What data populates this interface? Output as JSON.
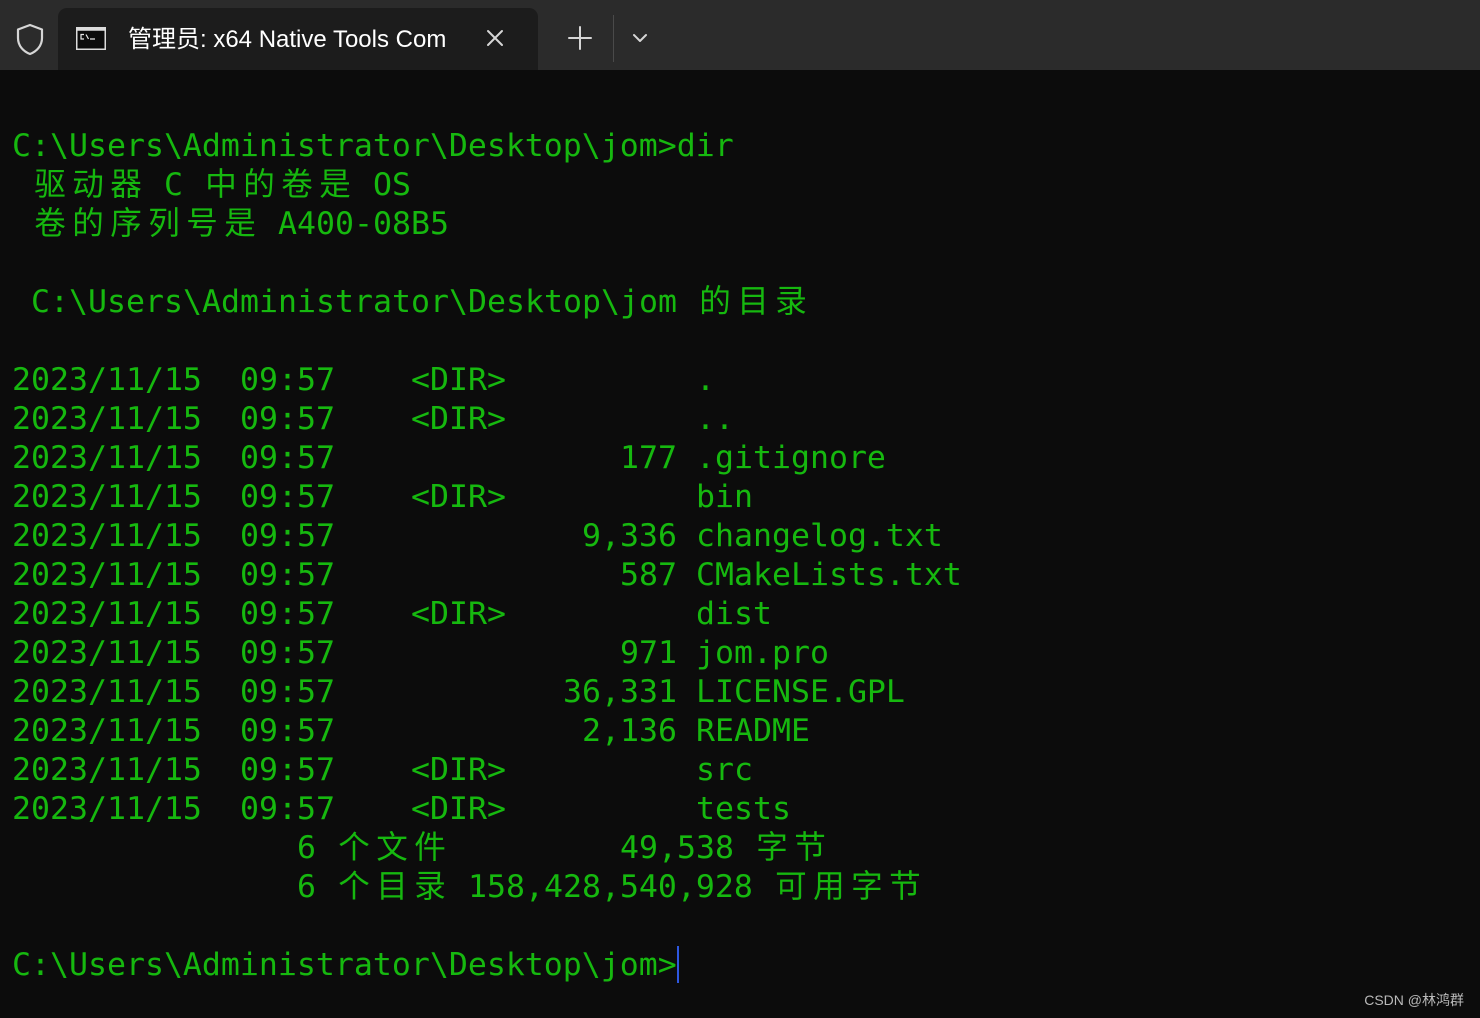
{
  "window": {
    "admin_icon": "shield-icon",
    "tab": {
      "icon": "cmd-icon",
      "title": "管理员: x64 Native Tools Com",
      "close_icon": "close-icon"
    },
    "new_tab_icon": "plus-icon",
    "tab_dropdown_icon": "chevron-down-icon"
  },
  "terminal": {
    "command_line": {
      "prompt": "C:\\Users\\Administrator\\Desktop\\jom>",
      "command": "dir"
    },
    "volume_line": "驱动器 C 中的卷是 OS",
    "serial_line": "卷的序列号是 A400-08B5",
    "directory_line": "C:\\Users\\Administrator\\Desktop\\jom 的目录",
    "listing": [
      {
        "date": "2023/11/15",
        "time": "09:57",
        "kind": "<DIR>",
        "name": "."
      },
      {
        "date": "2023/11/15",
        "time": "09:57",
        "kind": "<DIR>",
        "name": ".."
      },
      {
        "date": "2023/11/15",
        "time": "09:57",
        "size": "177",
        "name": ".gitignore"
      },
      {
        "date": "2023/11/15",
        "time": "09:57",
        "kind": "<DIR>",
        "name": "bin"
      },
      {
        "date": "2023/11/15",
        "time": "09:57",
        "size": "9,336",
        "name": "changelog.txt"
      },
      {
        "date": "2023/11/15",
        "time": "09:57",
        "size": "587",
        "name": "CMakeLists.txt"
      },
      {
        "date": "2023/11/15",
        "time": "09:57",
        "kind": "<DIR>",
        "name": "dist"
      },
      {
        "date": "2023/11/15",
        "time": "09:57",
        "size": "971",
        "name": "jom.pro"
      },
      {
        "date": "2023/11/15",
        "time": "09:57",
        "size": "36,331",
        "name": "LICENSE.GPL"
      },
      {
        "date": "2023/11/15",
        "time": "09:57",
        "size": "2,136",
        "name": "README"
      },
      {
        "date": "2023/11/15",
        "time": "09:57",
        "kind": "<DIR>",
        "name": "src"
      },
      {
        "date": "2023/11/15",
        "time": "09:57",
        "kind": "<DIR>",
        "name": "tests"
      }
    ],
    "summary": [
      {
        "count": "6",
        "label": "个文件",
        "amount": "49,538",
        "unit": "字节"
      },
      {
        "count": "6",
        "label": "个目录",
        "amount": "158,428,540,928",
        "unit": "可用字节"
      }
    ],
    "current_prompt": "C:\\Users\\Administrator\\Desktop\\jom>"
  },
  "watermark": "CSDN @林鸿群",
  "colors": {
    "terminal_bg": "#0c0c0c",
    "terminal_fg": "#16b80f",
    "tab_bar_bg": "#2b2b2b",
    "active_tab_bg": "#1c1c1c",
    "cursor": "#2e58e0",
    "icon": "#d6d6d6",
    "tab_title": "#ffffff",
    "watermark": "#b9b9b9"
  }
}
